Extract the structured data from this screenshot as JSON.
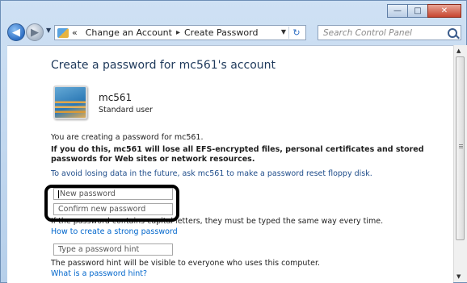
{
  "window": {
    "minimize_glyph": "—",
    "maximize_glyph": "□",
    "close_glyph": "✕"
  },
  "navbar": {
    "breadcrumb": [
      "Change an Account",
      "Create Password"
    ],
    "breadcrumb_prefix": "«",
    "separator": "▸",
    "search_placeholder": "Search Control Panel"
  },
  "page": {
    "title": "Create a password for mc561's account",
    "user": {
      "name": "mc561",
      "type": "Standard user"
    },
    "intro": "You are creating a password for mc561.",
    "warning": "If you do this, mc561 will lose all EFS-encrypted files, personal certificates and stored passwords for Web sites or network resources.",
    "reset_disk_note": "To avoid losing data in the future, ask mc561 to make a password reset floppy disk.",
    "new_password": {
      "value": "",
      "placeholder": "New password"
    },
    "confirm_password": {
      "value": "",
      "placeholder": "Confirm new password"
    },
    "capital_letters_note": "If the password contains capital letters, they must be typed the same way every time.",
    "strong_password_link": "How to create a strong password",
    "hint": {
      "value": "",
      "placeholder": "Type a password hint"
    },
    "hint_visibility_note": "The password hint will be visible to everyone who uses this computer.",
    "hint_help_link": "What is a password hint?"
  }
}
